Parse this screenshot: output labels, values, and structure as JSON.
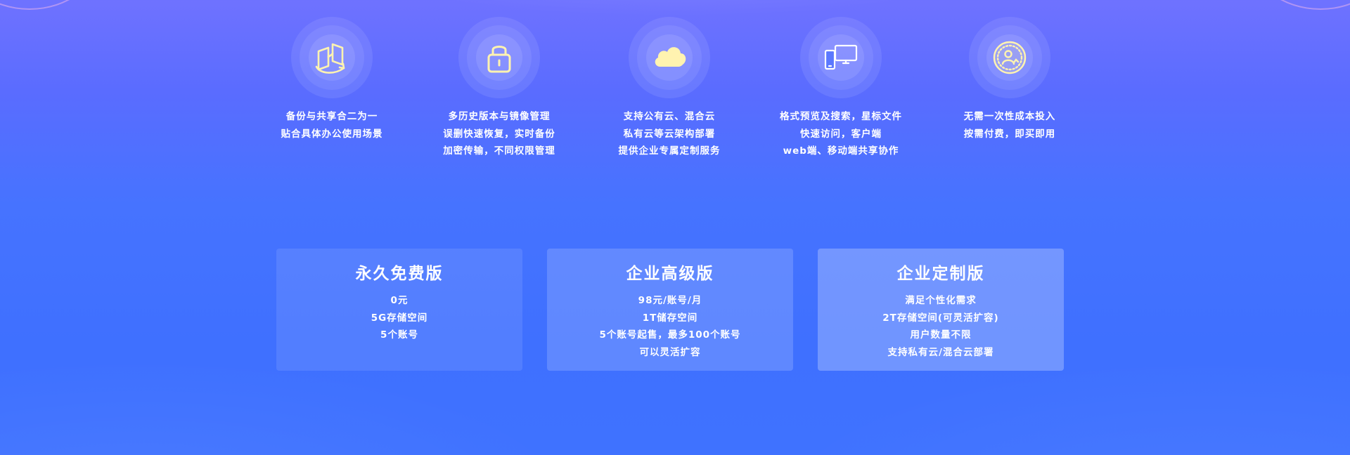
{
  "features": [
    {
      "icon": "backup-share-icon",
      "lines": [
        "备份与共享合二为一",
        "贴合具体办公使用场景"
      ]
    },
    {
      "icon": "lock-icon",
      "lines": [
        "多历史版本与镜像管理",
        "误删快速恢复，实时备份",
        "加密传输，不同权限管理"
      ]
    },
    {
      "icon": "cloud-icon",
      "lines": [
        "支持公有云、混合云",
        "私有云等云架构部署",
        "提供企业专属定制服务"
      ]
    },
    {
      "icon": "devices-icon",
      "lines": [
        "格式预览及搜索，星标文件",
        "快速访问，客户端",
        "web端、移动端共享协作"
      ]
    },
    {
      "icon": "user-badge-icon",
      "lines": [
        "无需一次性成本投入",
        "按需付费，即买即用"
      ]
    }
  ],
  "plans": [
    {
      "title": "永久免费版",
      "lines": [
        "0元",
        "5G存储空间",
        "5个账号"
      ]
    },
    {
      "title": "企业高级版",
      "lines": [
        "98元/账号/月",
        "1T储存空间",
        "5个账号起售，最多100个账号",
        "可以灵活扩容"
      ]
    },
    {
      "title": "企业定制版",
      "lines": [
        "满足个性化需求",
        "2T存储空间(可灵活扩容)",
        "用户数量不限",
        "支持私有云/混合云部署"
      ]
    }
  ],
  "colors": {
    "icon_accent": "#fff3b0",
    "background_top": "#6f72ff",
    "background_bottom": "#3f72ff"
  }
}
